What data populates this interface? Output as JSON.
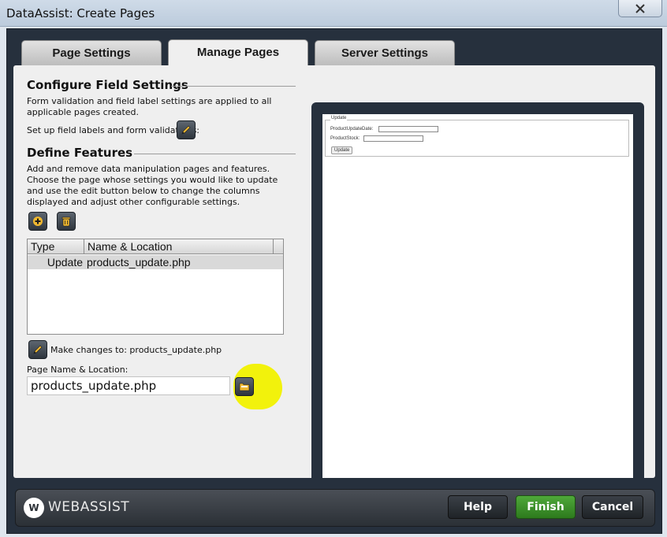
{
  "window": {
    "title": "DataAssist: Create Pages"
  },
  "tabs": [
    {
      "label": "Page Settings",
      "active": false
    },
    {
      "label": "Manage Pages",
      "active": true
    },
    {
      "label": "Server Settings",
      "active": false
    }
  ],
  "configure": {
    "title": "Configure Field Settings",
    "description": "Form validation and field label settings are applied to all applicable pages created.",
    "setup_label": "Set up field labels and form validations:"
  },
  "features": {
    "title": "Define Features",
    "description": "Add and remove data manipulation pages and features. Choose the page whose settings you would like to update and use the edit button below to change the columns displayed and adjust other configurable settings."
  },
  "grid": {
    "columns": [
      "Type",
      "Name & Location"
    ],
    "rows": [
      {
        "type": "Update",
        "name": "products_update.php",
        "selected": true
      }
    ]
  },
  "make_changes_label": "Make changes to: products_update.php",
  "page_name": {
    "label": "Page Name & Location:",
    "value": "products_update.php"
  },
  "preview": {
    "legend": "Update",
    "fields": [
      {
        "label": "ProductUpdateDate:"
      },
      {
        "label": "ProductStock:"
      }
    ],
    "button": "Update"
  },
  "footer": {
    "logo_mark": "W",
    "logo_text": "WEBASSIST",
    "help_label": "Help",
    "finish_label": "Finish",
    "cancel_label": "Cancel"
  },
  "colors": {
    "frame": "#26303d",
    "panel": "#efefef",
    "finish_green": "#3d8f2a",
    "highlight": "#f2f20c"
  },
  "icons": [
    "close-icon",
    "pencil-icon",
    "plus-icon",
    "trash-icon",
    "folder-icon"
  ]
}
